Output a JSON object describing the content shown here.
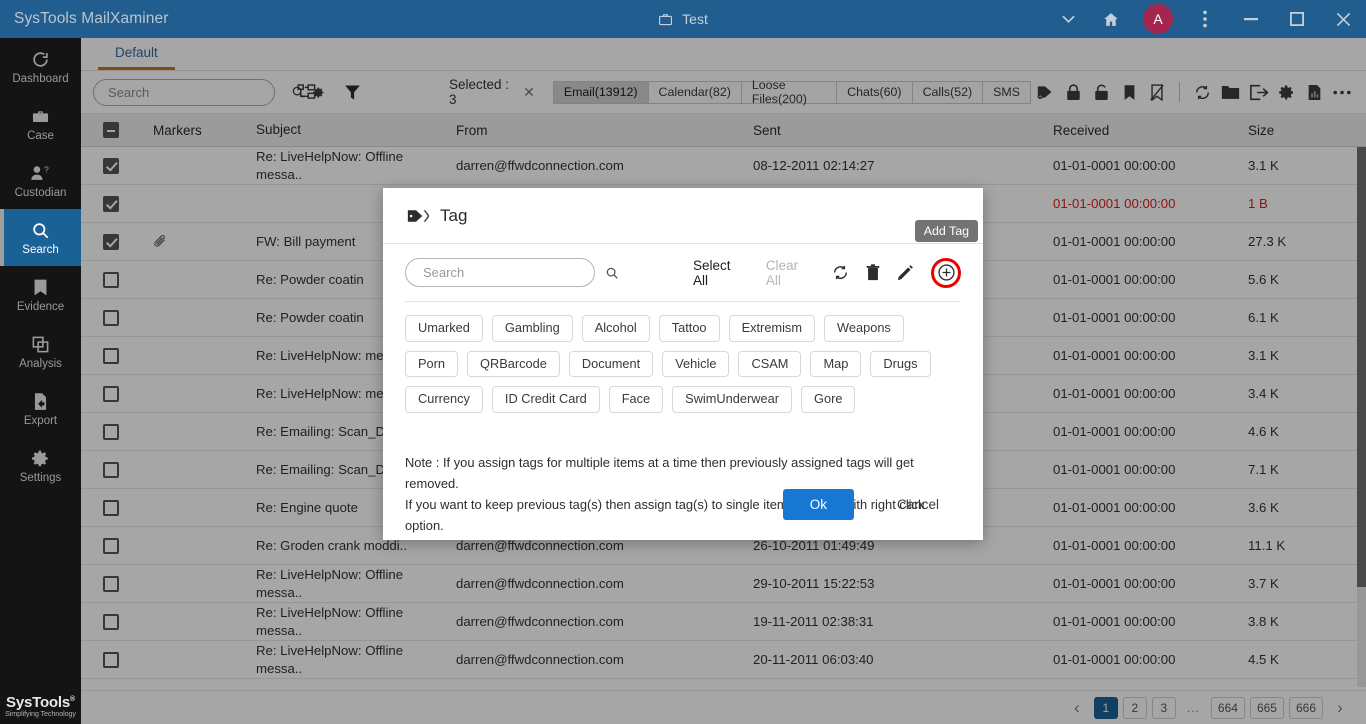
{
  "titlebar": {
    "brand": "SysTools MailXaminer",
    "case_name": "Test",
    "case_icon": "briefcase-icon",
    "caret_icon": "chevron-down-icon",
    "home_icon": "home-icon",
    "avatar_initial": "A",
    "more_icon": "kebab-menu-icon",
    "minimize_label": "–",
    "maximize_label": "❐",
    "close_label": "✕",
    "accent_color": "#215e8f",
    "avatar_color": "#a4264f"
  },
  "sidebar": {
    "items": [
      {
        "label": "Dashboard",
        "icon": "dashboard-refresh-icon",
        "active": false
      },
      {
        "label": "Case",
        "icon": "briefcase-icon",
        "active": false
      },
      {
        "label": "Custodian",
        "icon": "person-question-icon",
        "active": false
      },
      {
        "label": "Search",
        "icon": "magnifier-icon",
        "active": true
      },
      {
        "label": "Evidence",
        "icon": "bookmark-book-icon",
        "active": false
      },
      {
        "label": "Analysis",
        "icon": "layers-icon",
        "active": false
      },
      {
        "label": "Export",
        "icon": "file-export-icon",
        "active": false
      },
      {
        "label": "Settings",
        "icon": "gear-icon",
        "active": false
      }
    ],
    "logo_main": "SysTools",
    "logo_reg": "®",
    "logo_sub": "Simplifying Technology",
    "active_color": "#1a6196"
  },
  "workspace": {
    "tab_label": "Default",
    "tab_underline_color": "#c2781a",
    "search_placeholder": "Search",
    "search_value": "",
    "search_icon": "magnifier-icon",
    "search_settings_icon": "gear-icon",
    "tree_icon": "tree-view-icon",
    "filter_icon": "funnel-filter-icon",
    "selected_label": "Selected : 3",
    "selected_clear_icon": "close-icon",
    "category_tabs": [
      {
        "label": "Email(13912)",
        "active": true
      },
      {
        "label": "Calendar(82)",
        "active": false
      },
      {
        "label": "Loose Files(200)",
        "active": false
      },
      {
        "label": "Chats(60)",
        "active": false
      },
      {
        "label": "Calls(52)",
        "active": false
      },
      {
        "label": "SMS",
        "active": false
      }
    ],
    "right_icons": [
      "tag-add-icon",
      "lock-closed-icon",
      "lock-open-icon",
      "bookmark-icon",
      "bookmark-off-icon",
      "refresh-icon",
      "folder-icon",
      "export-icon",
      "gear-icon",
      "report-chart-icon",
      "more-horizontal-icon"
    ]
  },
  "table": {
    "columns": [
      "Markers",
      "Subject",
      "From",
      "Sent",
      "Received",
      "Size"
    ],
    "header_checkbox_state": "indeterminate",
    "rows": [
      {
        "checked": true,
        "attachment": false,
        "marker": "",
        "subject": "Re: LiveHelpNow: Offline messa..",
        "from": "darren@ffwdconnection.com",
        "sent": "08-12-2011 02:14:27",
        "received": "01-01-0001 00:00:00",
        "size": "3.1 K",
        "alert": false
      },
      {
        "checked": true,
        "attachment": false,
        "marker": "",
        "subject": "",
        "from": "",
        "sent": "",
        "received": "01-01-0001 00:00:00",
        "size": "1 B",
        "alert": true
      },
      {
        "checked": true,
        "attachment": true,
        "marker": "",
        "subject": "FW: Bill payment",
        "from": "",
        "sent": "",
        "received": "01-01-0001 00:00:00",
        "size": "27.3 K",
        "alert": false
      },
      {
        "checked": false,
        "attachment": false,
        "marker": "",
        "subject": "Re: Powder coatin",
        "from": "",
        "sent": "",
        "received": "01-01-0001 00:00:00",
        "size": "5.6 K",
        "alert": false
      },
      {
        "checked": false,
        "attachment": false,
        "marker": "",
        "subject": "Re: Powder coatin",
        "from": "",
        "sent": "",
        "received": "01-01-0001 00:00:00",
        "size": "6.1 K",
        "alert": false
      },
      {
        "checked": false,
        "attachment": false,
        "marker": "",
        "subject": "Re: LiveHelpNow: messa..",
        "from": "",
        "sent": "",
        "received": "01-01-0001 00:00:00",
        "size": "3.1 K",
        "alert": false
      },
      {
        "checked": false,
        "attachment": false,
        "marker": "",
        "subject": "Re: LiveHelpNow: messa..",
        "from": "",
        "sent": "",
        "received": "01-01-0001 00:00:00",
        "size": "3.4 K",
        "alert": false
      },
      {
        "checked": false,
        "attachment": false,
        "marker": "",
        "subject": "Re: Emailing: Scan_Doc0001.p",
        "from": "",
        "sent": "",
        "received": "01-01-0001 00:00:00",
        "size": "4.6 K",
        "alert": false
      },
      {
        "checked": false,
        "attachment": false,
        "marker": "",
        "subject": "Re: Emailing: Scan_Doc0001.p",
        "from": "",
        "sent": "",
        "received": "01-01-0001 00:00:00",
        "size": "7.1 K",
        "alert": false
      },
      {
        "checked": false,
        "attachment": false,
        "marker": "",
        "subject": "Re: Engine quote",
        "from": "",
        "sent": "",
        "received": "01-01-0001 00:00:00",
        "size": "3.6 K",
        "alert": false
      },
      {
        "checked": false,
        "attachment": false,
        "marker": "",
        "subject": "Re: Groden crank moddi..",
        "from": "darren@ffwdconnection.com",
        "sent": "26-10-2011 01:49:49",
        "received": "01-01-0001 00:00:00",
        "size": "11.1 K",
        "alert": false
      },
      {
        "checked": false,
        "attachment": false,
        "marker": "",
        "subject": "Re: LiveHelpNow: Offline messa..",
        "from": "darren@ffwdconnection.com",
        "sent": "29-10-2011 15:22:53",
        "received": "01-01-0001 00:00:00",
        "size": "3.7 K",
        "alert": false
      },
      {
        "checked": false,
        "attachment": false,
        "marker": "",
        "subject": "Re: LiveHelpNow: Offline messa..",
        "from": "darren@ffwdconnection.com",
        "sent": "19-11-2011 02:38:31",
        "received": "01-01-0001 00:00:00",
        "size": "3.8 K",
        "alert": false
      },
      {
        "checked": false,
        "attachment": false,
        "marker": "",
        "subject": "Re: LiveHelpNow: Offline messa..",
        "from": "darren@ffwdconnection.com",
        "sent": "20-11-2011 06:03:40",
        "received": "01-01-0001 00:00:00",
        "size": "4.5 K",
        "alert": false
      }
    ]
  },
  "pagination": {
    "prev_icon": "chevron-left-icon",
    "next_icon": "chevron-right-icon",
    "pages": [
      "1",
      "2",
      "3",
      "...",
      "664",
      "665",
      "666"
    ],
    "current": "1",
    "current_color": "#1a6196"
  },
  "modal": {
    "title": "Tag",
    "title_icon": "tag-icon",
    "search_placeholder": "Search",
    "search_value": "",
    "search_icon": "magnifier-icon",
    "select_all_label": "Select All",
    "clear_all_label": "Clear All",
    "refresh_icon": "refresh-icon",
    "delete_icon": "trash-icon",
    "edit_icon": "pencil-icon",
    "add_icon": "plus-circle-icon",
    "add_tooltip": "Add Tag",
    "highlight_color": "#ee0000",
    "tags": [
      "Umarked",
      "Gambling",
      "Alcohol",
      "Tattoo",
      "Extremism",
      "Weapons",
      "Porn",
      "QRBarcode",
      "Document",
      "Vehicle",
      "CSAM",
      "Map",
      "Drugs",
      "Currency",
      "ID Credit Card",
      "Face",
      "SwimUnderwear",
      "Gore"
    ],
    "note_line1": "Note : If you assign tags for multiple items at a time then previously assigned tags will get removed.",
    "note_line2": "If you want to keep previous tag(s) then assign tag(s) to single item at a time with right click option.",
    "ok_label": "Ok",
    "cancel_label": "Cancel",
    "ok_color": "#1877d2"
  }
}
